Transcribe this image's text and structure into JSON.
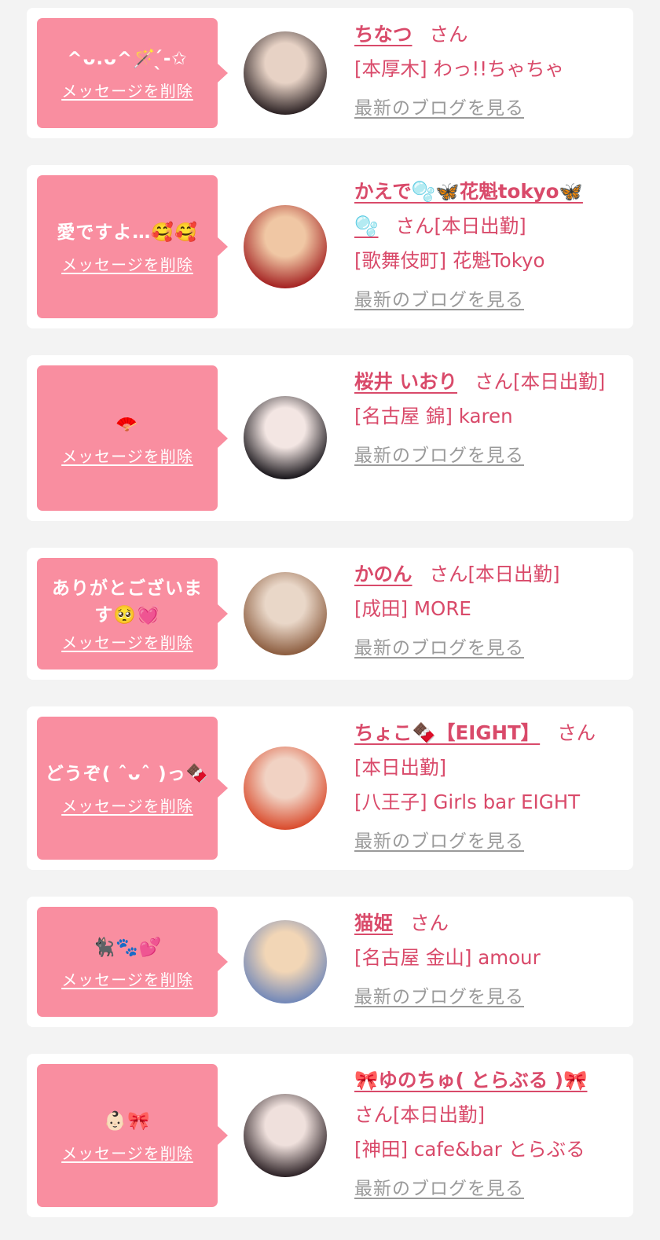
{
  "labels": {
    "suffix": "さん",
    "delete": "メッセージを削除",
    "blog": "最新のブログを見る"
  },
  "messages": [
    {
      "message": "^ᴗ.ᴗ^🪄 ̖́-✩",
      "name": "ちなつ",
      "attendance": "",
      "shop": "[本厚木] わっ!!ちゃちゃ",
      "avatar_colors": [
        "#e7d2c5",
        "#2a2022"
      ]
    },
    {
      "message": "愛ですよ…🥰🥰",
      "name": "かえで🫧🦋花魁tokyo🦋🫧",
      "attendance": "[本日出勤]",
      "shop": "[歌舞伎町] 花魁Tokyo",
      "avatar_colors": [
        "#f0c7a4",
        "#a32020"
      ]
    },
    {
      "message": "🪭",
      "name": "桜井 いおり",
      "attendance": "[本日出勤]",
      "shop": "[名古屋 錦] karen",
      "avatar_colors": [
        "#f3e6e3",
        "#151217"
      ]
    },
    {
      "message": "ありがとございます🥺💓",
      "name": "かのん",
      "attendance": "[本日出勤]",
      "shop": "[成田] MORE",
      "avatar_colors": [
        "#e9d7c8",
        "#8a5a3c"
      ]
    },
    {
      "message": "どうぞ( ˆᴗˆ )っ🍫",
      "name": "ちょこ🍫【EIGHT】",
      "attendance": "[本日出勤]",
      "shop": "[八王子] Girls bar EIGHT",
      "avatar_colors": [
        "#f1d2c3",
        "#d9492a"
      ]
    },
    {
      "message": "🐈‍⬛🐾💕",
      "name": "猫姫",
      "attendance": "",
      "shop": "[名古屋 金山] amour",
      "avatar_colors": [
        "#f2d6b6",
        "#6f86b8"
      ]
    },
    {
      "message": "👶🏻🎀",
      "name": "🎀ゆのちゅ( とらぶる )🎀",
      "attendance": "[本日出勤]",
      "shop": "[神田] cafe&bar とらぶる",
      "avatar_colors": [
        "#efe0dc",
        "#2a1f23"
      ]
    }
  ]
}
